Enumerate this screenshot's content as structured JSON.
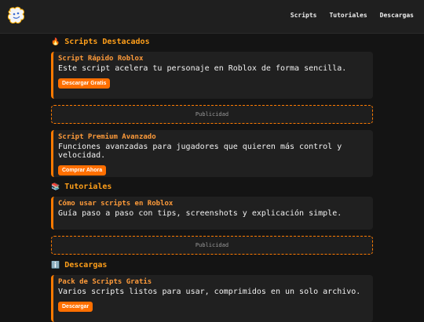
{
  "nav": {
    "items": [
      "Scripts",
      "Tutoriales",
      "Descargas"
    ]
  },
  "sections": {
    "scripts": {
      "icon": "fire-icon",
      "title": "Scripts Destacados"
    },
    "tutorials": {
      "icon": "books-icon",
      "title": "Tutoriales"
    },
    "downloads": {
      "icon": "info-icon",
      "title": "Descargas"
    }
  },
  "cards": [
    {
      "title": "Script Rápido Roblox",
      "desc": "Este script acelera tu personaje en Roblox de forma sencilla.",
      "button": "Descargar Gratis"
    },
    {
      "title": "Script Premium Avanzado",
      "desc": "Funciones avanzadas para jugadores que quieren más control y velocidad.",
      "button": "Comprar Ahora"
    },
    {
      "title": "Cómo usar scripts en Roblox",
      "desc": "Guía paso a paso con tips, screenshots y explicación simple."
    },
    {
      "title": "Pack de Scripts Gratis",
      "desc": "Varios scripts listos para usar, comprimidos en un solo archivo.",
      "button": "Descargar"
    }
  ],
  "ads": {
    "label": "Publicidad"
  },
  "colors": {
    "accent": "#ff7a00",
    "title": "#ff9f1a",
    "background": "#141414"
  }
}
